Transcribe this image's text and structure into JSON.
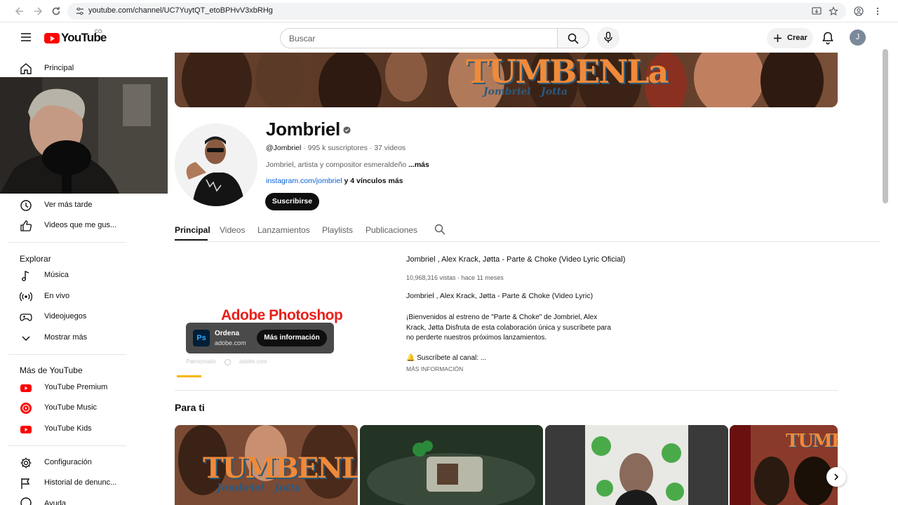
{
  "browser": {
    "url": "youtube.com/channel/UC7YuytQT_etoBPHvV3xbRHg"
  },
  "header": {
    "logo_text": "YouTube",
    "logo_region": "CO",
    "search_placeholder": "Buscar",
    "create_label": "Crear",
    "avatar_initial": "J"
  },
  "sidebar": {
    "top_items": [
      {
        "label": "Principal",
        "icon": "home-icon"
      }
    ],
    "you_items": [
      {
        "label": "Ver más tarde",
        "icon": "clock-icon"
      },
      {
        "label": "Videos que me gus...",
        "icon": "thumbs-up-icon"
      }
    ],
    "explore_title": "Explorar",
    "explore_items": [
      {
        "label": "Música",
        "icon": "music-icon"
      },
      {
        "label": "En vivo",
        "icon": "live-icon"
      },
      {
        "label": "Videojuegos",
        "icon": "gamepad-icon"
      },
      {
        "label": "Mostrar más",
        "icon": "chevron-down-icon"
      }
    ],
    "more_title": "Más de YouTube",
    "more_items": [
      {
        "label": "YouTube Premium",
        "icon": "youtube-premium-icon"
      },
      {
        "label": "YouTube Music",
        "icon": "youtube-music-icon"
      },
      {
        "label": "YouTube Kids",
        "icon": "youtube-kids-icon"
      }
    ],
    "bottom_items": [
      {
        "label": "Configuración",
        "icon": "gear-icon"
      },
      {
        "label": "Historial de denunc...",
        "icon": "flag-icon"
      },
      {
        "label": "Ayuda",
        "icon": "help-icon"
      }
    ]
  },
  "banner": {
    "title": "TUMBENLa",
    "artists": "Jombriel   Jotta"
  },
  "channel": {
    "name": "Jombriel",
    "handle": "@Jombriel",
    "meta": "· 995 k suscriptores · 37 videos",
    "description": "Jombriel, artista y compositor esmeraldeño",
    "description_more": "...más",
    "link": "instagram.com/jombriel",
    "links_more": "y 4 vínculos más",
    "subscribe_label": "Suscribirse"
  },
  "tabs": [
    "Principal",
    "Videos",
    "Lanzamientos",
    "Playlists",
    "Publicaciones"
  ],
  "ad": {
    "brand": "Adobe Photoshop",
    "cta_title": "Ordena",
    "domain": "adobe.com",
    "button": "Más información",
    "sponsored": "Patrocinado",
    "sponsored_domain": "adobe.com"
  },
  "featured": {
    "title": "Jombriel , Alex Krack, Jøtta - Parte & Choke (Video Lyric Oficial)",
    "meta": "10,968,316 vistas · hace 11 meses",
    "desc1": "Jombriel , Alex Krack, Jøtta - Parte & Choke (Video Lyric)",
    "desc2": "¡Bienvenidos al estreno de \"Parte & Choke\" de Jombriel, Alex Krack, Jøtta  Disfruta de esta colaboración única y suscríbete para no perderte nuestros próximos lanzamientos.",
    "desc3": "🔔 Suscríbete al canal:      ...",
    "more": "MÁS INFORMACIÓN"
  },
  "for_you": {
    "title": "Para ti"
  },
  "colors": {
    "brand_red": "#ff0000",
    "link_blue": "#065fd4",
    "text_secondary": "#606060"
  }
}
